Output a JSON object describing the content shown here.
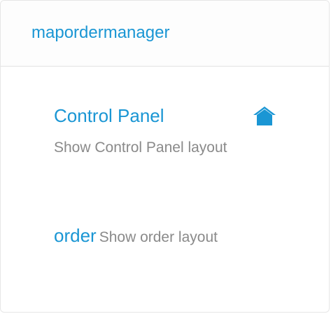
{
  "panel": {
    "title": "mapordermanager"
  },
  "menu": {
    "items": [
      {
        "title": "Control Panel",
        "description": "Show Control Panel layout",
        "icon": "home-icon"
      },
      {
        "title": "order",
        "description": "Show order layout"
      }
    ]
  },
  "colors": {
    "accent": "#1a96d4",
    "muted_text": "#8a8a8a",
    "border": "#e3e3e3"
  }
}
